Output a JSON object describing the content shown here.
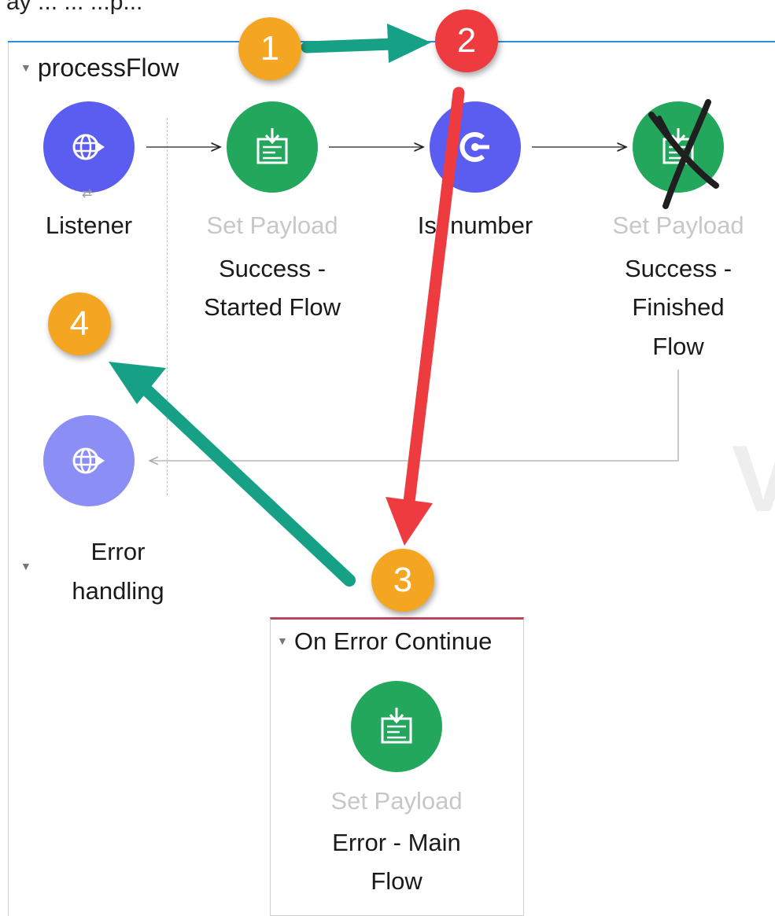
{
  "top_text": "ay ... ... ...p...",
  "flow": {
    "title": "processFlow",
    "nodes": [
      {
        "type": "",
        "name": "Listener",
        "color": "#5b5df0",
        "icon": "globe-arrow-icon"
      },
      {
        "type": "Set Payload",
        "name": "Success - Started Flow",
        "lines": [
          "Success -",
          "Started Flow"
        ],
        "color": "#22a75c",
        "icon": "set-payload-icon"
      },
      {
        "type": "",
        "name": "Is number",
        "visible": "Is  number",
        "color": "#5b5df0",
        "icon": "choice-icon"
      },
      {
        "type": "Set Payload",
        "name": "Success - Finished Flow",
        "lines": [
          "Success -",
          "Finished",
          "Flow"
        ],
        "color": "#22a75c",
        "icon": "set-payload-icon",
        "crossed_out": true
      }
    ],
    "return_node": {
      "color": "#8b8ef5",
      "icon": "globe-arrow-icon"
    }
  },
  "error_handling": {
    "label_lines": [
      "Error",
      "handling"
    ],
    "scope": {
      "title": "On Error Continue",
      "node": {
        "type": "Set Payload",
        "lines": [
          "Error - Main",
          "Flow"
        ],
        "color": "#22a75c",
        "icon": "set-payload-icon"
      }
    }
  },
  "watermark": "V",
  "annotations": {
    "badges": [
      {
        "label": "1",
        "color": "#f4a623"
      },
      {
        "label": "2",
        "color": "#ee3b3f"
      },
      {
        "label": "3",
        "color": "#f4a623"
      },
      {
        "label": "4",
        "color": "#f4a623"
      }
    ],
    "arrow_colors": {
      "teal": "#16a085",
      "red": "#ee3b3f"
    }
  }
}
